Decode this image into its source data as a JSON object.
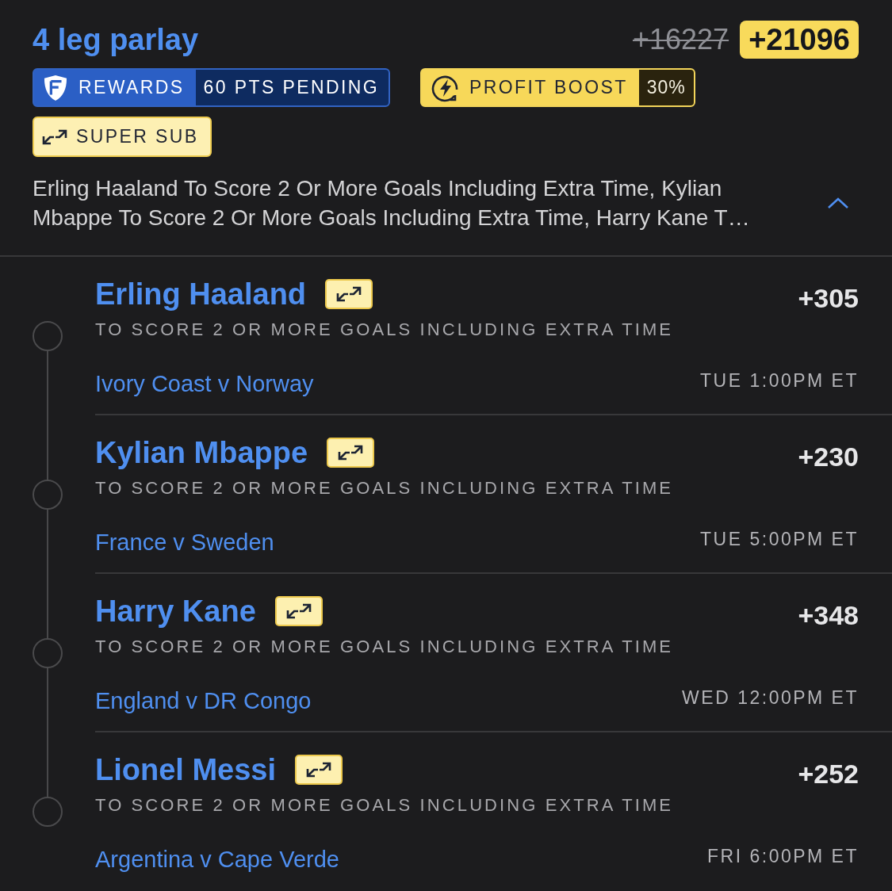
{
  "header": {
    "title": "4 leg parlay",
    "original_odds": "+16227",
    "boosted_odds": "+21096"
  },
  "tags": [
    {
      "kind": "rewards",
      "label": "REWARDS",
      "value": "60 PTS PENDING"
    },
    {
      "kind": "profit_boost",
      "label": "PROFIT BOOST",
      "value": "30%"
    },
    {
      "kind": "super_sub",
      "label": "SUPER SUB"
    }
  ],
  "summary": {
    "text": "Erling Haaland To Score 2 Or More Goals Including Extra Time, Kylian Mbappe To Score 2 Or More Goals Including Extra Time, Harry Kane T…",
    "expanded": true
  },
  "legs": [
    {
      "player": "Erling Haaland",
      "super_sub": true,
      "odds": "+305",
      "market": "TO SCORE 2 OR MORE GOALS INCLUDING EXTRA TIME",
      "matchup": "Ivory Coast v Norway",
      "time": "TUE 1:00PM ET"
    },
    {
      "player": "Kylian Mbappe",
      "super_sub": true,
      "odds": "+230",
      "market": "TO SCORE 2 OR MORE GOALS INCLUDING EXTRA TIME",
      "matchup": "France v Sweden",
      "time": "TUE 5:00PM ET"
    },
    {
      "player": "Harry Kane",
      "super_sub": true,
      "odds": "+348",
      "market": "TO SCORE 2 OR MORE GOALS INCLUDING EXTRA TIME",
      "matchup": "England v DR Congo",
      "time": "WED 12:00PM ET"
    },
    {
      "player": "Lionel Messi",
      "super_sub": true,
      "odds": "+252",
      "market": "TO SCORE 2 OR MORE GOALS INCLUDING EXTRA TIME",
      "matchup": "Argentina v Cape Verde",
      "time": "FRI 6:00PM ET"
    }
  ]
}
